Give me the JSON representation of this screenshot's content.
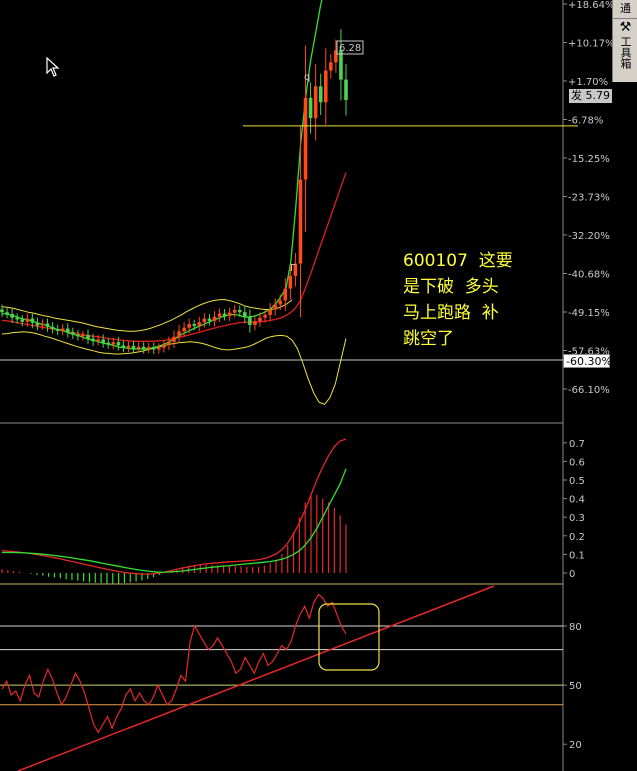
{
  "chart_data": [
    {
      "type": "candlestick",
      "panel": "price",
      "y_axis_ticks": [
        "+18.64%",
        "+10.17%",
        "+1.70%",
        "-6.78%",
        "-15.25%",
        "-23.73%",
        "-32.20%",
        "-40.68%",
        "-49.15%",
        "-57.63%",
        "-66.10%"
      ],
      "high_label": "6.28",
      "peak_marker": "q",
      "gap_marker": "Γ",
      "current_price_tag": "发 5.79",
      "pct_tag": "-60.30%",
      "ylim_pct": [
        -70,
        20
      ],
      "closes_pct": [
        -49.2,
        -49.6,
        -50.4,
        -50.8,
        -51.3,
        -50.6,
        -51.5,
        -52.1,
        -51.7,
        -52.4,
        -52.9,
        -53.3,
        -52.8,
        -53.6,
        -54.1,
        -54.5,
        -54.2,
        -55.0,
        -55.6,
        -55.2,
        -55.9,
        -56.3,
        -55.8,
        -56.5,
        -57.0,
        -56.6,
        -57.2,
        -56.8,
        -57.3,
        -56.9,
        -57.4,
        -57.0,
        -56.4,
        -55.7,
        -54.6,
        -53.4,
        -52.6,
        -51.8,
        -52.2,
        -51.4,
        -50.6,
        -51.1,
        -50.2,
        -49.5,
        -50.0,
        -49.3,
        -48.7,
        -49.2,
        -50.3,
        -52.0,
        -51.2,
        -50.4,
        -49.8,
        -48.6,
        -47.5,
        -46.6,
        -44.0,
        -41.2,
        -38.5,
        -20.0,
        -2.0,
        -6.5,
        0.5,
        -3.0,
        4.0,
        5.8,
        8.5,
        2.0,
        -2.5
      ],
      "ma_green_pct": [
        -49.5,
        -49.6,
        -49.9,
        -50.2,
        -50.6,
        -50.8,
        -51.1,
        -51.5,
        -51.8,
        -52.1,
        -52.5,
        -52.9,
        -53.1,
        -53.5,
        -53.9,
        -54.2,
        -54.5,
        -54.9,
        -55.2,
        -55.5,
        -55.8,
        -56.1,
        -56.3,
        -56.6,
        -56.9,
        -57.0,
        -57.2,
        -57.3,
        -57.3,
        -57.3,
        -57.2,
        -57.0,
        -56.7,
        -56.3,
        -55.8,
        -55.2,
        -54.5,
        -53.9,
        -53.4,
        -52.9,
        -52.4,
        -52.0,
        -51.5,
        -51.0,
        -50.6,
        -50.2,
        -49.9,
        -49.7,
        -49.8,
        -50.1,
        -50.3,
        -50.2,
        -49.9,
        -49.5,
        -49.0,
        -48.3,
        -47.2,
        -45.7,
        -43.9,
        -38.0,
        -26.0,
        -12.0,
        -2.0,
        6.0,
        12.0,
        18.0,
        23.0,
        26.0,
        28.0
      ],
      "ma_red_pct": [
        -51.0,
        -51.1,
        -51.3,
        -51.5,
        -51.7,
        -51.9,
        -52.1,
        -52.3,
        -52.5,
        -52.7,
        -52.9,
        -53.1,
        -53.3,
        -53.5,
        -53.7,
        -53.9,
        -54.1,
        -54.3,
        -54.5,
        -54.6,
        -54.8,
        -55.0,
        -55.1,
        -55.3,
        -55.4,
        -55.5,
        -55.6,
        -55.6,
        -55.6,
        -55.6,
        -55.6,
        -55.5,
        -55.4,
        -55.2,
        -55.0,
        -54.8,
        -54.5,
        -54.2,
        -53.9,
        -53.6,
        -53.3,
        -53.0,
        -52.7,
        -52.4,
        -52.2,
        -51.9,
        -51.7,
        -51.5,
        -51.4,
        -51.4,
        -51.4,
        -51.3,
        -51.2,
        -51.0,
        -50.8,
        -50.5,
        -50.0,
        -49.3,
        -48.3,
        -46.6,
        -43.8,
        -40.8,
        -37.6,
        -34.4,
        -31.2,
        -28.0,
        -24.8,
        -21.6,
        -18.5
      ],
      "band_upper_pct": [
        -48.0,
        -48.1,
        -48.3,
        -48.6,
        -48.9,
        -49.2,
        -49.4,
        -49.7,
        -50.0,
        -50.2,
        -50.5,
        -50.7,
        -50.9,
        -51.1,
        -51.3,
        -51.5,
        -51.8,
        -52.1,
        -52.4,
        -52.6,
        -52.8,
        -53.0,
        -53.2,
        -53.3,
        -53.4,
        -53.4,
        -53.3,
        -53.1,
        -52.8,
        -52.4,
        -52.0,
        -51.5,
        -51.0,
        -50.4,
        -49.8,
        -49.1,
        -48.5,
        -47.9,
        -47.4,
        -47.0,
        -46.7,
        -46.5,
        -46.4,
        -46.6,
        -46.9,
        -47.3,
        -47.8,
        -48.1,
        -48.3,
        -48.5,
        -48.6,
        -48.6,
        -48.4,
        -48.0,
        -47.4,
        -46.5
      ],
      "band_lower_pct": [
        -54.0,
        -53.9,
        -53.7,
        -53.6,
        -53.5,
        -53.6,
        -53.8,
        -54.1,
        -54.5,
        -54.8,
        -55.2,
        -55.6,
        -56.0,
        -56.4,
        -56.8,
        -57.1,
        -57.4,
        -57.7,
        -58.0,
        -58.2,
        -58.3,
        -58.4,
        -58.4,
        -58.3,
        -58.2,
        -58.0,
        -57.8,
        -57.5,
        -57.2,
        -56.9,
        -56.6,
        -56.3,
        -56.1,
        -55.9,
        -55.8,
        -55.7,
        -55.8,
        -56.0,
        -56.3,
        -56.7,
        -57.1,
        -57.4,
        -57.5,
        -57.4,
        -57.2,
        -57.0,
        -56.7,
        -56.2,
        -55.6,
        -55.0,
        -54.6,
        -54.4,
        -54.3,
        -54.5,
        -55.4,
        -57.3,
        -60.5,
        -64.0,
        -67.0,
        -69.0,
        -69.5,
        -68.0,
        -65.0,
        -60.0,
        -55.0
      ],
      "support_line_pct": -8.2
    },
    {
      "type": "bar",
      "panel": "macd",
      "y_axis_ticks": [
        "0.7",
        "0.6",
        "0.5",
        "0.4",
        "0.3",
        "0.2",
        "0.1",
        "0"
      ],
      "ylim": [
        -0.05,
        0.75
      ],
      "dif": [
        0.12,
        0.118,
        0.115,
        0.112,
        0.108,
        0.104,
        0.099,
        0.094,
        0.088,
        0.082,
        0.076,
        0.069,
        0.062,
        0.055,
        0.048,
        0.041,
        0.034,
        0.027,
        0.02,
        0.014,
        0.008,
        0.003,
        -0.001,
        -0.004,
        -0.006,
        -0.006,
        -0.004,
        0.0,
        0.006,
        0.013,
        0.02,
        0.027,
        0.034,
        0.04,
        0.045,
        0.049,
        0.052,
        0.055,
        0.058,
        0.06,
        0.062,
        0.064,
        0.066,
        0.068,
        0.072,
        0.078,
        0.088,
        0.102,
        0.125,
        0.16,
        0.21,
        0.27,
        0.34,
        0.42,
        0.5,
        0.57,
        0.63,
        0.68,
        0.71,
        0.72
      ],
      "dea": [
        0.11,
        0.11,
        0.11,
        0.109,
        0.108,
        0.106,
        0.104,
        0.101,
        0.098,
        0.094,
        0.09,
        0.086,
        0.081,
        0.076,
        0.071,
        0.066,
        0.06,
        0.054,
        0.048,
        0.042,
        0.036,
        0.03,
        0.024,
        0.019,
        0.014,
        0.01,
        0.007,
        0.005,
        0.005,
        0.006,
        0.008,
        0.011,
        0.015,
        0.019,
        0.023,
        0.027,
        0.031,
        0.034,
        0.037,
        0.04,
        0.043,
        0.046,
        0.049,
        0.052,
        0.055,
        0.058,
        0.062,
        0.067,
        0.074,
        0.085,
        0.1,
        0.12,
        0.15,
        0.19,
        0.24,
        0.3,
        0.36,
        0.42,
        0.48,
        0.56
      ],
      "macd_hist": [
        0.02,
        0.016,
        0.01,
        0.006,
        0.0,
        -0.004,
        -0.01,
        -0.014,
        -0.02,
        -0.024,
        -0.028,
        -0.034,
        -0.038,
        -0.042,
        -0.046,
        -0.05,
        -0.052,
        -0.054,
        -0.056,
        -0.056,
        -0.056,
        -0.054,
        -0.05,
        -0.046,
        -0.04,
        -0.032,
        -0.022,
        -0.01,
        0.002,
        0.014,
        0.024,
        0.032,
        0.038,
        0.042,
        0.044,
        0.044,
        0.042,
        0.042,
        0.042,
        0.04,
        0.038,
        0.036,
        0.034,
        0.032,
        0.034,
        0.04,
        0.052,
        0.07,
        0.102,
        0.15,
        0.22,
        0.3,
        0.38,
        0.42,
        0.42,
        0.4,
        0.38,
        0.35,
        0.31,
        0.26
      ]
    },
    {
      "type": "line",
      "panel": "oscillator",
      "y_axis_ticks": [
        "80",
        "50",
        "20"
      ],
      "ylim": [
        10,
        100
      ],
      "hlines": [
        80,
        68,
        50,
        40
      ],
      "values": [
        48,
        52,
        45,
        47,
        42,
        50,
        55,
        46,
        44,
        52,
        58,
        53,
        46,
        40,
        44,
        50,
        56,
        52,
        46,
        38,
        30,
        26,
        30,
        34,
        28,
        34,
        38,
        45,
        48,
        42,
        46,
        42,
        40,
        44,
        50,
        45,
        40,
        42,
        48,
        55,
        52,
        72,
        80,
        76,
        72,
        68,
        70,
        74,
        70,
        66,
        62,
        56,
        58,
        64,
        60,
        56,
        62,
        66,
        60,
        62,
        66,
        70,
        68,
        72,
        80,
        86,
        90,
        84,
        92,
        96,
        94,
        90,
        92,
        86,
        80,
        76
      ],
      "trendline": [
        [
          0,
          1
        ],
        [
          494,
          99
        ]
      ]
    }
  ],
  "annotation_text": [
    "600107  这要",
    "是下破  多头",
    "马上跑路  补",
    "跳空了"
  ],
  "sidebar": {
    "tab_label": "通",
    "tool_label": "工具箱",
    "tool_icon": "hammer-wrench-icon"
  },
  "colors": {
    "background": "#000000",
    "up_candle": "#ff4a1a",
    "down_candle": "#4fd34f",
    "ma_green": "#33e033",
    "ma_red": "#e01e1e",
    "band": "#f0e040",
    "macd_bar": "#e62828",
    "dif_line": "#e62828",
    "dea_line": "#33e033",
    "osc_line": "#e62828",
    "osc_box": "#f0e040",
    "text_highlight": "#ffff3a"
  }
}
